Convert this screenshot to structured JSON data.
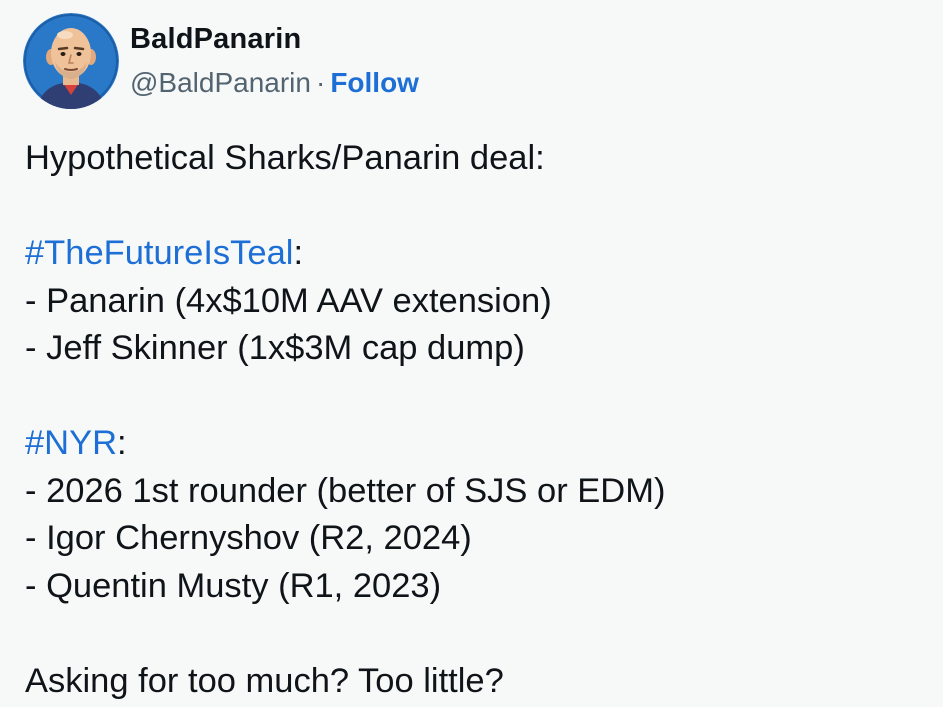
{
  "author": {
    "display_name": "BaldPanarin",
    "handle": "@BaldPanarin",
    "separator": "·",
    "follow_label": "Follow",
    "avatar_icon": "bald-man-cartoon-avatar"
  },
  "tweet": {
    "line1": "Hypothetical Sharks/Panarin deal:",
    "sharks_hashtag": "#TheFutureIsTeal",
    "sharks_colon": ":",
    "sharks_items": [
      "- Panarin (4x$10M AAV extension)",
      "- Jeff Skinner (1x$3M cap dump)"
    ],
    "nyr_hashtag": "#NYR",
    "nyr_colon": ":",
    "nyr_items": [
      "- 2026 1st rounder (better of SJS or EDM)",
      "- Igor Chernyshov (R2, 2024)",
      "- Quentin Musty (R1, 2023)"
    ],
    "closing": "Asking for too much? Too little?"
  },
  "colors": {
    "background": "#f7f9f9",
    "text": "#0f1419",
    "secondary_text": "#536471",
    "link": "#1d6fd6",
    "avatar_bg": "#2a78c8"
  }
}
